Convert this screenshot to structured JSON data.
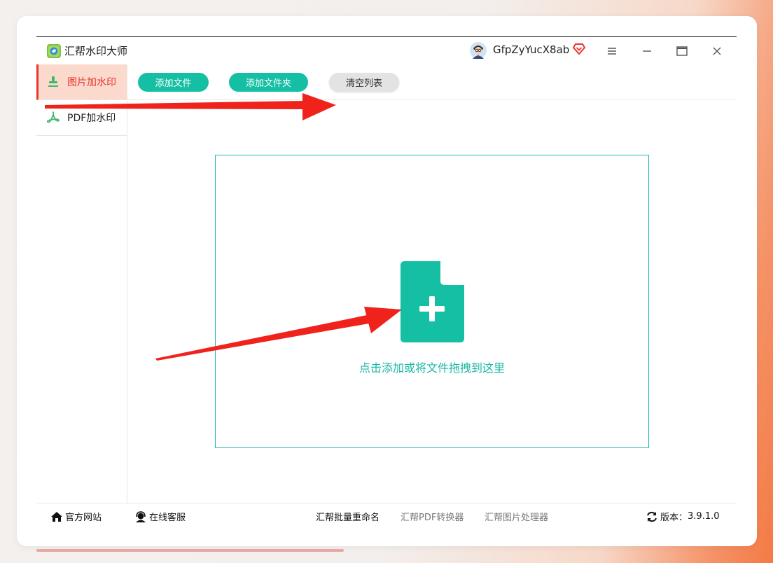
{
  "app": {
    "title": "汇帮水印大师"
  },
  "user": {
    "name": "GfpZyYucX8ab"
  },
  "window_controls": [
    "menu",
    "minimize",
    "maximize",
    "close"
  ],
  "sidebar": {
    "items": [
      {
        "label": "图片加水印",
        "icon": "stamp-icon",
        "active": true
      },
      {
        "label": "PDF加水印",
        "icon": "pdf-icon",
        "active": false
      }
    ]
  },
  "toolbar": {
    "add_file": "添加文件",
    "add_folder": "添加文件夹",
    "clear_list": "清空列表"
  },
  "dropzone": {
    "text": "点击添加或将文件拖拽到这里",
    "icon": "file-add-icon"
  },
  "footer": {
    "website": "官方网站",
    "support": "在线客服",
    "link_rename": "汇帮批量重命名",
    "link_pdf": "汇帮PDF转换器",
    "link_image": "汇帮图片处理器",
    "version_label": "版本：",
    "version_value": "3.9.1.0"
  },
  "colors": {
    "accent": "#14bfa3",
    "active_red": "#e9352e",
    "active_bg": "#fcd9cd",
    "arrow": "#f0231c"
  }
}
